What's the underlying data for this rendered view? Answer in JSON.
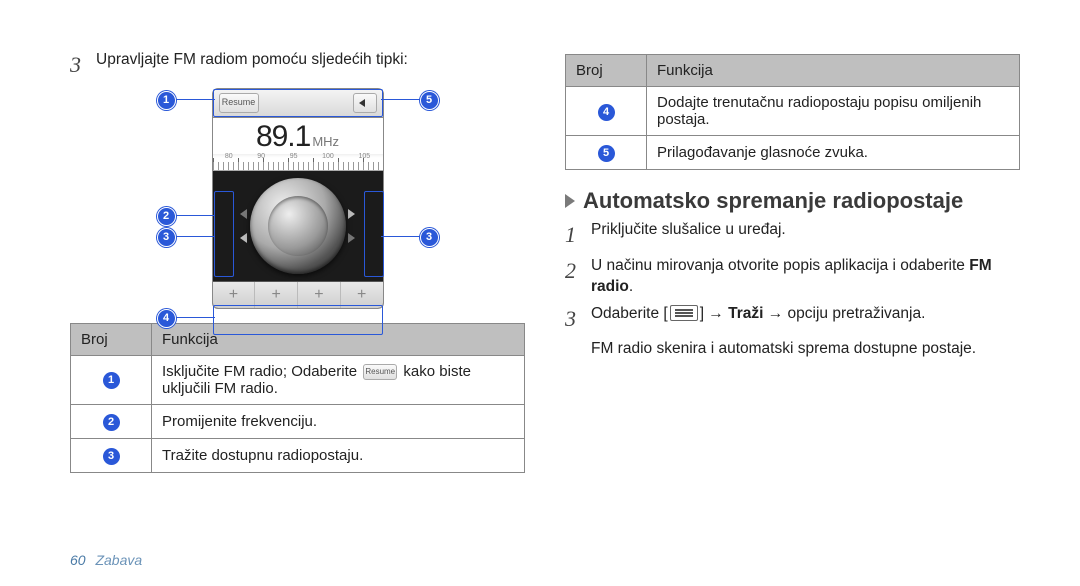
{
  "left": {
    "step3": "Upravljajte FM radiom pomoću sljedećih tipki:",
    "radio": {
      "resume_label": "Resume",
      "freq_value": "89.1",
      "freq_unit": "MHz",
      "ruler_marks": [
        "80",
        "90",
        "95",
        "100",
        "105"
      ],
      "preset_cells": [
        "+",
        "+",
        "+",
        "+"
      ]
    },
    "table": {
      "head": {
        "num": "Broj",
        "func": "Funkcija"
      },
      "rows": [
        {
          "n": "1",
          "func_a": "Isključite FM radio; Odaberite ",
          "func_b": " kako biste uključili FM radio."
        },
        {
          "n": "2",
          "func": "Promijenite frekvenciju."
        },
        {
          "n": "3",
          "func": "Tražite dostupnu radiopostaju."
        }
      ],
      "row1_icon_label": "Resume"
    }
  },
  "right": {
    "table": {
      "head": {
        "num": "Broj",
        "func": "Funkcija"
      },
      "rows": [
        {
          "n": "4",
          "func": "Dodajte trenutačnu radiopostaju popisu omiljenih postaja."
        },
        {
          "n": "5",
          "func": "Prilagođavanje glasnoće zvuka."
        }
      ]
    },
    "section_title": "Automatsko spremanje radiopostaje",
    "step1": "Priključite slušalice u uređaj.",
    "step2": "U načinu mirovanja otvorite popis aplikacija i odaberite ",
    "step2_bold": "FM radio",
    "step2_tail": ".",
    "step3_a": "Odaberite [",
    "step3_b": "] → ",
    "step3_bold1": "Traži",
    "step3_c": " → opciju pretraživanja.",
    "step3_after": "FM radio skenira i automatski sprema dostupne postaje."
  },
  "footer": {
    "page": "60",
    "section": "Zabava"
  }
}
